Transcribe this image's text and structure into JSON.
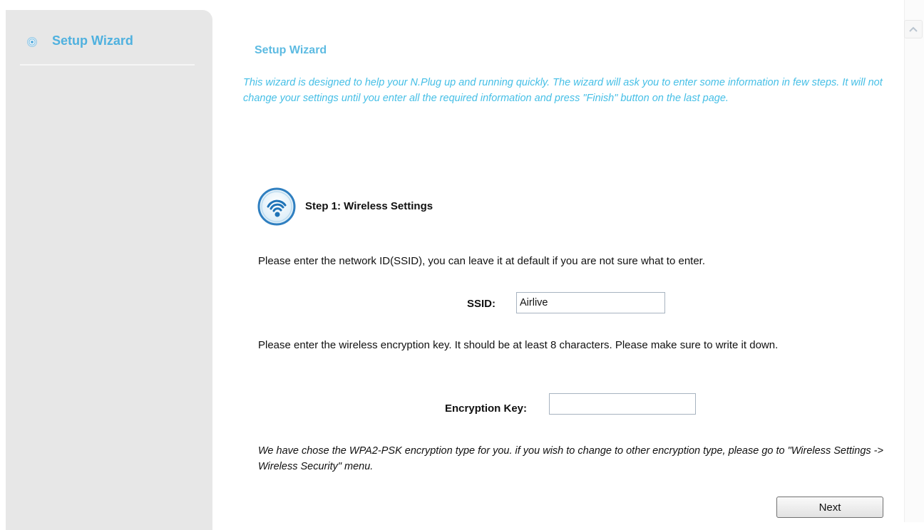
{
  "sidebar": {
    "items": [
      {
        "label": "Setup Wizard",
        "icon": "target-bullet-icon"
      }
    ]
  },
  "main": {
    "title": "Setup Wizard",
    "intro": "This wizard is designed to help your N.Plug up and running quickly. The wizard will ask you to enter some information in few steps. It will not change your settings until you enter all the required information and press \"Finish\" button on the last page.",
    "step": {
      "icon": "wireless-signal-icon",
      "title": "Step 1: Wireless Settings"
    },
    "ssid_instruction": "Please enter the network ID(SSID), you can leave it at default if you are not sure what to enter.",
    "ssid": {
      "label": "SSID:",
      "value": "Airlive"
    },
    "key_instruction": "Please enter the wireless encryption key. It should be at least 8 characters. Please make sure to write it down.",
    "encryption_key": {
      "label": "Encryption Key:",
      "value": ""
    },
    "note": "We have chose the WPA2-PSK encryption type for you.  if you wish to change to other encryption type, please go to \"Wireless Settings -> Wireless Security\" menu.",
    "next_label": "Next"
  },
  "colors": {
    "accent": "#4fb1df",
    "intro_text": "#46bfe6",
    "sidebar_bg": "#e7e7e7"
  }
}
